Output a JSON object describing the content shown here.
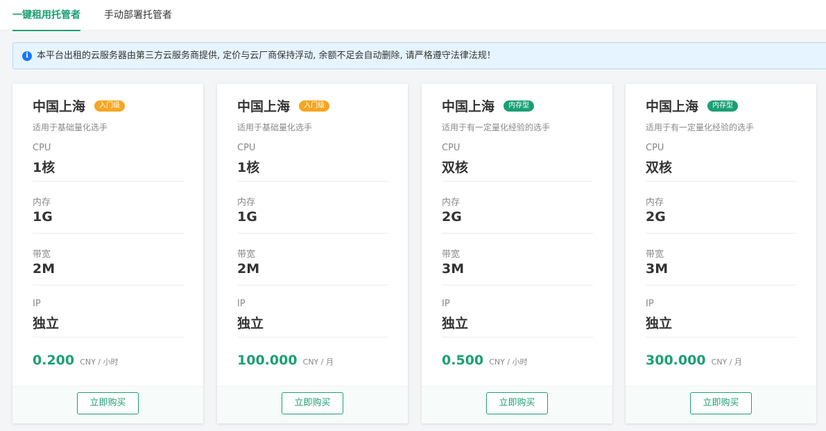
{
  "tabs": [
    {
      "label": "一键租用托管者",
      "active": true
    },
    {
      "label": "手动部署托管者",
      "active": false
    }
  ],
  "notice": {
    "icon": "info-icon",
    "text": "本平台出租的云服务器由第三方云服务商提供, 定价与云厂商保持浮动, 余额不足会自动删除, 请严格遵守法律法规！"
  },
  "colors": {
    "accent": "#1a9f74",
    "badge_entry": "#f5a623",
    "badge_memory": "#1a9f74",
    "notice_bg": "#e6f4ff"
  },
  "spec_labels": {
    "cpu": "CPU",
    "memory": "内存",
    "bandwidth": "带宽",
    "ip": "IP"
  },
  "cards": [
    {
      "title": "中国上海",
      "badge": "入门级",
      "badge_type": "entry",
      "desc": "适用于基础量化选手",
      "cpu": "1核",
      "memory": "1G",
      "bandwidth": "2M",
      "ip": "独立",
      "price": "0.200",
      "unit": "CNY / 小时",
      "button": "立即购买"
    },
    {
      "title": "中国上海",
      "badge": "入门级",
      "badge_type": "entry",
      "desc": "适用于基础量化选手",
      "cpu": "1核",
      "memory": "1G",
      "bandwidth": "2M",
      "ip": "独立",
      "price": "100.000",
      "unit": "CNY / 月",
      "button": "立即购买"
    },
    {
      "title": "中国上海",
      "badge": "内存型",
      "badge_type": "memory",
      "desc": "适用于有一定量化经验的选手",
      "cpu": "双核",
      "memory": "2G",
      "bandwidth": "3M",
      "ip": "独立",
      "price": "0.500",
      "unit": "CNY / 小时",
      "button": "立即购买"
    },
    {
      "title": "中国上海",
      "badge": "内存型",
      "badge_type": "memory",
      "desc": "适用于有一定量化经验的选手",
      "cpu": "双核",
      "memory": "2G",
      "bandwidth": "3M",
      "ip": "独立",
      "price": "300.000",
      "unit": "CNY / 月",
      "button": "立即购买"
    }
  ]
}
